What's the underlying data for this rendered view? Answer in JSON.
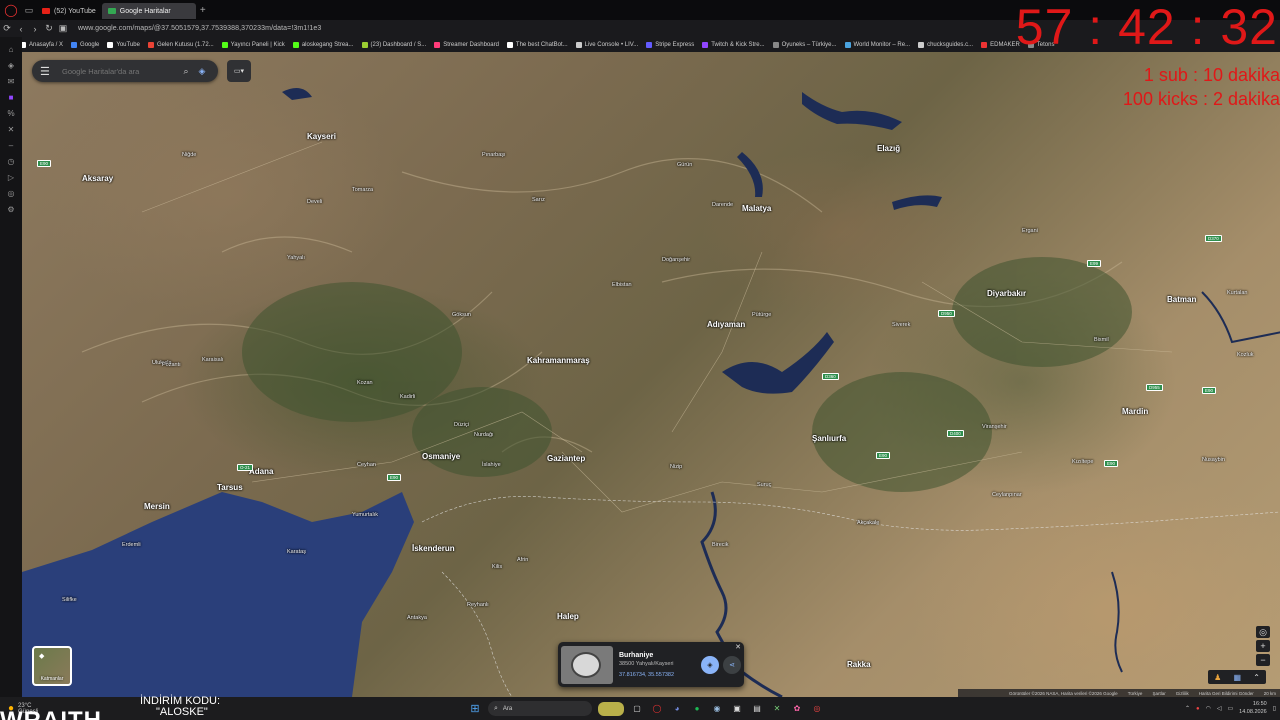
{
  "browser": {
    "tabs": [
      {
        "label": "(52) YouTube",
        "active": false,
        "color": "#e62117"
      },
      {
        "label": "Google Haritalar",
        "active": true,
        "color": "#34a853"
      }
    ],
    "url": "www.google.com/maps/@37.5051579,37.7539388,370233m/data=!3m1!1e3",
    "bookmarks": [
      {
        "label": "Anasayfa / X",
        "color": "#ffffff"
      },
      {
        "label": "Google",
        "color": "#4285f4"
      },
      {
        "label": "YouTube",
        "color": "#ffffff"
      },
      {
        "label": "Gelen Kutusu (1.72...",
        "color": "#ea4335"
      },
      {
        "label": "Yayıncı Paneli | Kick",
        "color": "#53fc18"
      },
      {
        "label": "aloskegang Strea...",
        "color": "#53fc18"
      },
      {
        "label": "(23) Dashboard / S...",
        "color": "#9acd32"
      },
      {
        "label": "Streamer Dashboard",
        "color": "#ff3c7a"
      },
      {
        "label": "The best ChatBot...",
        "color": "#ffffff"
      },
      {
        "label": "Live Console • LIV...",
        "color": "#cccccc"
      },
      {
        "label": "Stripe Express",
        "color": "#635bff"
      },
      {
        "label": "Twitch & Kick Stre...",
        "color": "#9146ff"
      },
      {
        "label": "Oyuneks – Türkiye...",
        "color": "#888888"
      },
      {
        "label": "World Monitor – Re...",
        "color": "#4aa3df"
      },
      {
        "label": "chucksguides.c...",
        "color": "#cccccc"
      },
      {
        "label": "EDMAKER",
        "color": "#e33"
      },
      {
        "label": "Tetons",
        "color": "#888888"
      }
    ]
  },
  "overlay": {
    "timer": "57 : 42 : 32",
    "sub_rule": "1 sub : 10 dakika",
    "kick_rule": "100 kicks : 2 dakika",
    "color": "#e01818"
  },
  "maps": {
    "search_placeholder": "Google Haritalar'da ara",
    "layers_label": "Katmanlar",
    "place": {
      "name": "Burhaniye",
      "address": "38500 Yahyalı/Kayseri",
      "coords": "37.816734, 35.557382"
    },
    "footer": [
      "Görüntüler ©2026 NASA, Harita verileri ©2026 Google",
      "Türkiye",
      "Şartlar",
      "Gizlilik",
      "Harita Geri Bildirimi Gönder",
      "20 km"
    ],
    "cities": [
      {
        "name": "Kayseri",
        "size": "big"
      },
      {
        "name": "Aksaray",
        "size": "big"
      },
      {
        "name": "Malatya",
        "size": "big"
      },
      {
        "name": "Elazığ",
        "size": "big"
      },
      {
        "name": "Diyarbakır",
        "size": "big"
      },
      {
        "name": "Batman",
        "size": "big"
      },
      {
        "name": "Adıyaman",
        "size": "big"
      },
      {
        "name": "Kahramanmaraş",
        "size": "big"
      },
      {
        "name": "Osmaniye",
        "size": "big"
      },
      {
        "name": "Gaziantep",
        "size": "big"
      },
      {
        "name": "Adana",
        "size": "big"
      },
      {
        "name": "Mersin",
        "size": "big"
      },
      {
        "name": "Şanlıurfa",
        "size": "big"
      },
      {
        "name": "Mardin",
        "size": "big"
      },
      {
        "name": "İskenderun",
        "size": "big"
      },
      {
        "name": "Halep",
        "size": "big"
      },
      {
        "name": "Tarsus",
        "size": "big"
      },
      {
        "name": "Rakka",
        "size": "big"
      },
      {
        "name": "Yahyalı",
        "size": "small"
      },
      {
        "name": "Develi",
        "size": "small"
      },
      {
        "name": "Tomarza",
        "size": "small"
      },
      {
        "name": "Niğde",
        "size": "small"
      },
      {
        "name": "Ulukışla",
        "size": "small"
      },
      {
        "name": "Pozantı",
        "size": "small"
      },
      {
        "name": "Kozan",
        "size": "small"
      },
      {
        "name": "Kadirli",
        "size": "small"
      },
      {
        "name": "Ceyhan",
        "size": "small"
      },
      {
        "name": "Düziçi",
        "size": "small"
      },
      {
        "name": "Nurdağı",
        "size": "small"
      },
      {
        "name": "İslahiye",
        "size": "small"
      },
      {
        "name": "Kilis",
        "size": "small"
      },
      {
        "name": "Nizip",
        "size": "small"
      },
      {
        "name": "Birecik",
        "size": "small"
      },
      {
        "name": "Siverek",
        "size": "small"
      },
      {
        "name": "Kozluk",
        "size": "small"
      },
      {
        "name": "Karataş",
        "size": "small"
      },
      {
        "name": "Yumurtalık",
        "size": "small"
      },
      {
        "name": "Erdemli",
        "size": "small"
      },
      {
        "name": "Silifke",
        "size": "small"
      },
      {
        "name": "Antakya",
        "size": "small"
      },
      {
        "name": "Elbistan",
        "size": "small"
      },
      {
        "name": "Göksun",
        "size": "small"
      },
      {
        "name": "Pınarbaşı",
        "size": "small"
      },
      {
        "name": "Sarız",
        "size": "small"
      },
      {
        "name": "Gürün",
        "size": "small"
      },
      {
        "name": "Darende",
        "size": "small"
      },
      {
        "name": "Doğanşehir",
        "size": "small"
      },
      {
        "name": "Pütürge",
        "size": "small"
      },
      {
        "name": "Ergani",
        "size": "small"
      },
      {
        "name": "Viranşehir",
        "size": "small"
      },
      {
        "name": "Ceylanpınar",
        "size": "small"
      },
      {
        "name": "Akçakale",
        "size": "small"
      },
      {
        "name": "Suruç",
        "size": "small"
      },
      {
        "name": "Bismil",
        "size": "small"
      },
      {
        "name": "Kurtalan",
        "size": "small"
      },
      {
        "name": "Kızıltepe",
        "size": "small"
      },
      {
        "name": "Nusaybin",
        "size": "small"
      },
      {
        "name": "Afrin",
        "size": "small"
      },
      {
        "name": "Reyhanlı",
        "size": "small"
      },
      {
        "name": "Karaisalı",
        "size": "small"
      }
    ]
  },
  "taskbar": {
    "weather_temp": "23°C",
    "weather_desc": "Güneşli",
    "promo_title": "İNDİRİM KODU:",
    "promo_code": "\"ALOSKE\"",
    "brand": "WRAITH",
    "search_label": "Ara",
    "time": "16:50",
    "date": "14.08.2026"
  }
}
